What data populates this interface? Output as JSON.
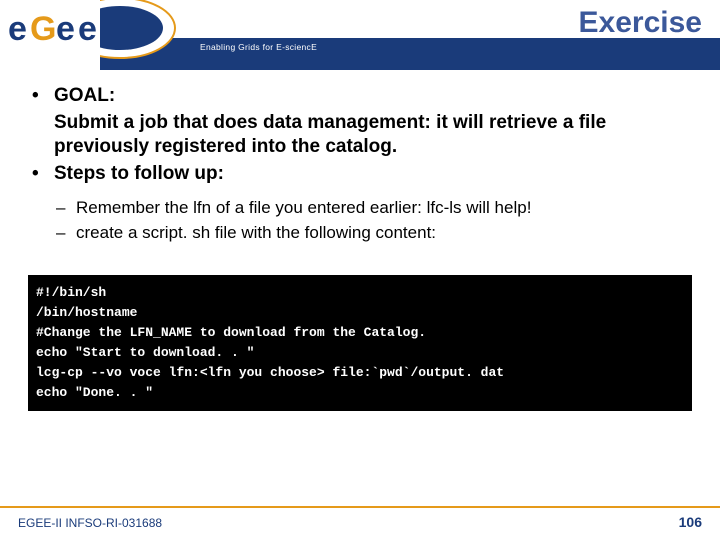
{
  "header": {
    "title": "Exercise",
    "tagline": "Enabling Grids for E-sciencE",
    "logo_text": "eGee"
  },
  "bullets": {
    "level1": [
      "GOAL:",
      "Submit a job that does data management: it will retrieve a file previously registered into the catalog.",
      "Steps to follow up:"
    ],
    "level2": [
      "Remember the lfn of a file you entered earlier: lfc-ls will help!",
      "create a script. sh file with the following content:"
    ]
  },
  "code": {
    "l1": "#!/bin/sh",
    "l2": "/bin/hostname",
    "l3": "#Change the LFN_NAME to download from the Catalog.",
    "l4": "echo \"Start to download. . \"",
    "l5": "lcg-cp --vo voce lfn:<lfn you choose> file:`pwd`/output. dat",
    "l6": "echo \"Done. . \""
  },
  "footer": {
    "left": "EGEE-II INFSO-RI-031688",
    "page": "106"
  }
}
